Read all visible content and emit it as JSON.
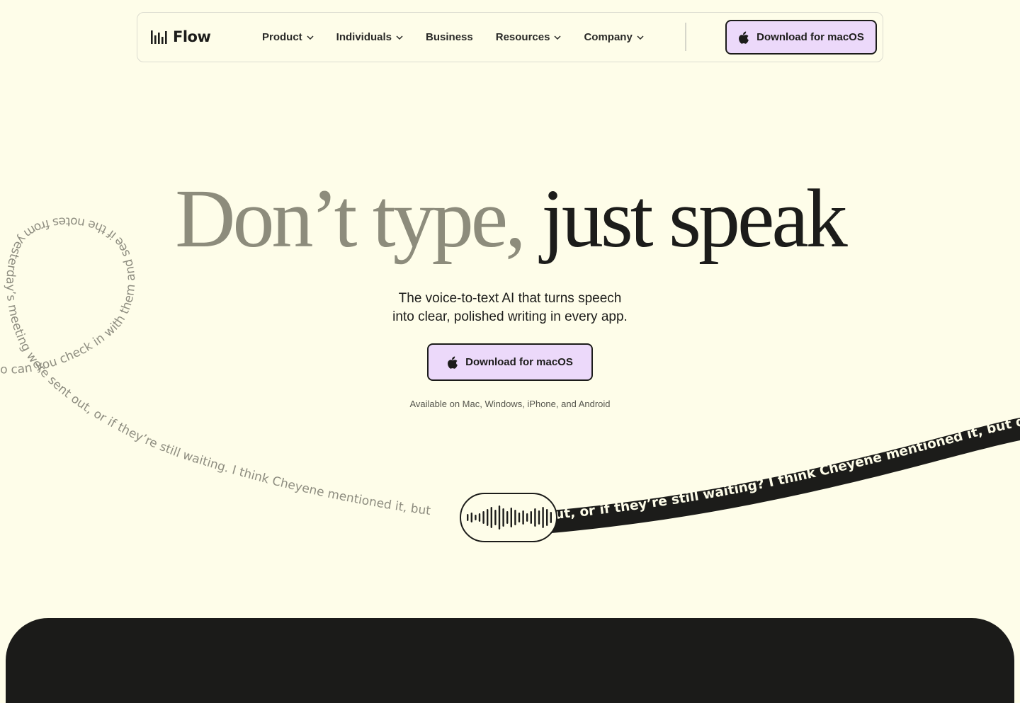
{
  "nav": {
    "brand": "Flow",
    "menu": [
      {
        "label": "Product",
        "has_dropdown": true
      },
      {
        "label": "Individuals",
        "has_dropdown": true
      },
      {
        "label": "Business",
        "has_dropdown": false
      },
      {
        "label": "Resources",
        "has_dropdown": true
      },
      {
        "label": "Company",
        "has_dropdown": true
      }
    ],
    "cta_label": "Download for macOS"
  },
  "hero": {
    "headline_muted": "Don’t type,",
    "headline_strong": "just speak",
    "subhead_line1": "The voice-to-text AI that turns speech",
    "subhead_line2": "into clear, polished writing in every app.",
    "cta_label": "Download for macOS",
    "availability": "Available on Mac, Windows, iPhone, and Android"
  },
  "decor": {
    "spoken_text": "o can you check in with them and see if the notes from yesterday’s meeting were sent out, or if they’re still waiting. I think Cheyene mentioned it, but",
    "transcribed_text": "ut, or if they’re still waiting? I think Cheyene mentioned it, but didn’t"
  },
  "colors": {
    "background": "#fefde9",
    "accent": "#ecd9fa",
    "ink": "#1c1c1a",
    "muted": "#8d8c7c"
  },
  "icons": {
    "logo": "waveform-bars-icon",
    "cta": "apple-icon",
    "dropdown": "chevron-down-icon",
    "voice": "waveform-icon"
  }
}
